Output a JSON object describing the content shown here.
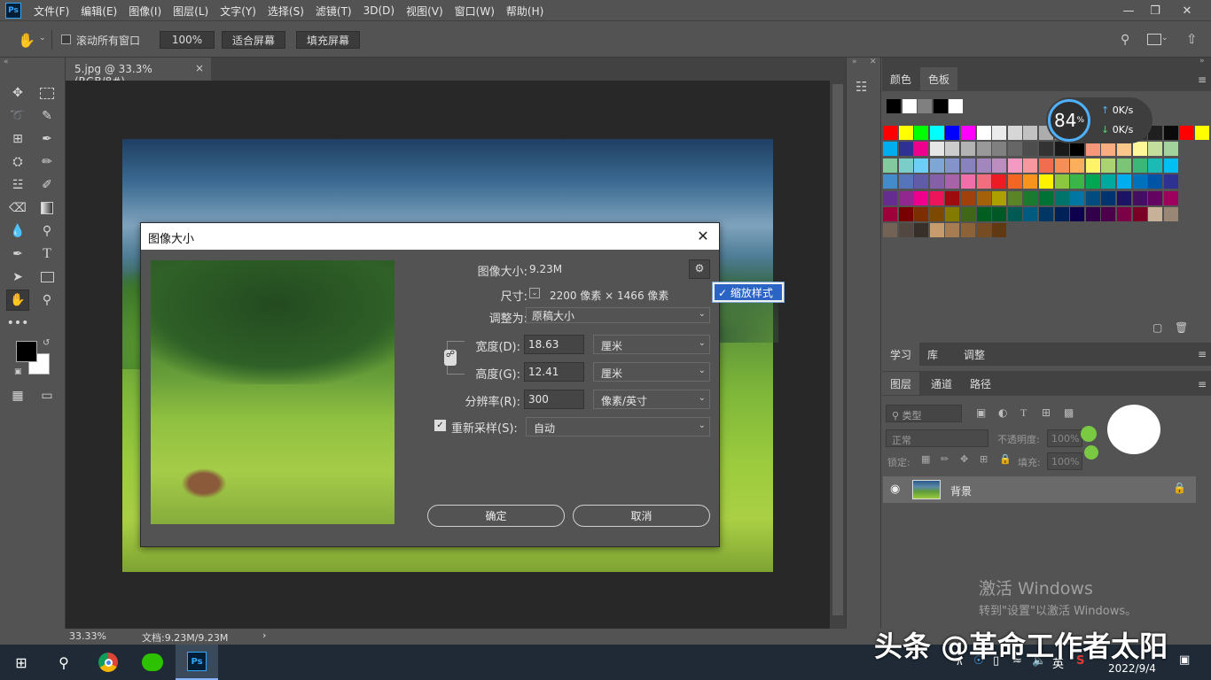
{
  "app": {
    "logo": "Ps",
    "menus": [
      "文件(F)",
      "编辑(E)",
      "图像(I)",
      "图层(L)",
      "文字(Y)",
      "选择(S)",
      "滤镜(T)",
      "3D(D)",
      "视图(V)",
      "窗口(W)",
      "帮助(H)"
    ],
    "window_controls": [
      "minimize-icon",
      "restore-icon",
      "close-icon"
    ]
  },
  "options_bar": {
    "scroll_all_label": "滚动所有窗口",
    "zoom_value": "100%",
    "fit_screen": "适合屏幕",
    "fill_screen": "填充屏幕"
  },
  "document": {
    "tab_title": "5.jpg @ 33.3%(RGB/8#)",
    "tab_close": "×",
    "zoom_status": "33.33%",
    "doc_status": "文档:9.23M/9.23M",
    "status_arrow": "›"
  },
  "dialog": {
    "title": "图像大小",
    "close": "✕",
    "image_size_label": "图像大小:",
    "image_size_value": "9.23M",
    "dimensions_label": "尺寸:",
    "dimensions_value": "2200 像素 × 1466 像素",
    "fit_to_label": "调整为:",
    "fit_to_value": "原稿大小",
    "width_label": "宽度(D):",
    "width_value": "18.63",
    "width_unit": "厘米",
    "height_label": "高度(G):",
    "height_value": "12.41",
    "height_unit": "厘米",
    "resolution_label": "分辨率(R):",
    "resolution_value": "300",
    "resolution_unit": "像素/英寸",
    "resample_label": "重新采样(S):",
    "resample_checked": true,
    "resample_value": "自动",
    "ok": "确定",
    "cancel": "取消",
    "gear_menu_item": "缩放样式"
  },
  "right_panel": {
    "swatch_tabs": [
      "颜色",
      "色板"
    ],
    "speed_percent": "84",
    "speed_percent_unit": "%",
    "up_speed": "0K/s",
    "down_speed": "0K/s",
    "learn_tabs": [
      "学习",
      "库",
      "调整"
    ],
    "layer_tabs": [
      "图层",
      "通道",
      "路径"
    ],
    "kind_filter": "类型",
    "blend_mode": "正常",
    "opacity_label": "不透明度:",
    "opacity_value": "100%",
    "lock_label": "锁定:",
    "fill_label": "填充:",
    "fill_value": "100%",
    "layer_name": "背景"
  },
  "colors": {
    "accent": "#31a8ff",
    "selection": "#2a64c5",
    "row1": [
      "#000000",
      "#ffffff",
      "#808080",
      "#000000",
      "#ffffff"
    ],
    "grid": [
      [
        "#ff0000",
        "#ffff00",
        "#00ff00",
        "#00ffff",
        "#0000ff",
        "#ff00ff",
        "#ffffff",
        "#ebebeb",
        "#d6d6d6",
        "#c2c2c2",
        "#adadad",
        "#999999",
        "#858585",
        "#707070",
        "#5c5c5c",
        "#474747",
        "#333333",
        "#1f1f1f",
        "#0a0a0a",
        "#ff0000",
        "#ffff00",
        "#00a651"
      ],
      [
        "#00aeef",
        "#2e3192",
        "#ec008c",
        "#e6e6e6",
        "#cccccc",
        "#b3b3b3",
        "#999999",
        "#808080",
        "#666666",
        "#4d4d4d",
        "#333333",
        "#1a1a1a",
        "#000000",
        "#f7977a",
        "#f9ad81",
        "#fdc68a",
        "#fff79a",
        "#c4df9b",
        "#a2d39c"
      ],
      [
        "#82ca9d",
        "#7bcdc8",
        "#6ecff6",
        "#7ea7d8",
        "#8493ca",
        "#8882be",
        "#a187be",
        "#bc8dbf",
        "#f49ac2",
        "#f6989d",
        "#f26c4f",
        "#f68e55",
        "#fbaf5c",
        "#fff467",
        "#acd372",
        "#7cc576",
        "#3bb878",
        "#1abbb4",
        "#00bff3"
      ],
      [
        "#438ccb",
        "#5574b9",
        "#605ca8",
        "#855fa8",
        "#a763a8",
        "#f06eaa",
        "#f26d7d",
        "#ed1c24",
        "#f26522",
        "#f7941d",
        "#fff200",
        "#8dc73f",
        "#39b54a",
        "#00a651",
        "#00a99d",
        "#00aeef",
        "#0072bc",
        "#0054a6",
        "#2e3192"
      ],
      [
        "#662d91",
        "#92278f",
        "#ec008c",
        "#ed145b",
        "#9e0b0f",
        "#a0410d",
        "#a3620a",
        "#aba000",
        "#598527",
        "#1a7b30",
        "#007236",
        "#00746b",
        "#0076a3",
        "#004b80",
        "#003471",
        "#1b1464",
        "#440e62",
        "#630460",
        "#9e005d"
      ],
      [
        "#9e0039",
        "#790000",
        "#7b2e00",
        "#7d4900",
        "#827b00",
        "#406618",
        "#005e20",
        "#005826",
        "#005952",
        "#005b7f",
        "#003663",
        "#002157",
        "#0d004c",
        "#32004b",
        "#4b0049",
        "#7b0046",
        "#7a0026",
        "#c7b299",
        "#998675"
      ],
      [
        "#736357",
        "#534741",
        "#37302a",
        "#c69c6d",
        "#a67c52",
        "#8c6239",
        "#754c24",
        "#603913"
      ]
    ]
  },
  "watermark": {
    "line1": "激活 Windows",
    "line2": "转到\"设置\"以激活 Windows。"
  },
  "taskbar": {
    "ime": "英",
    "date": "2022/9/4",
    "overlay": "头条 @革命工作者太阳"
  }
}
